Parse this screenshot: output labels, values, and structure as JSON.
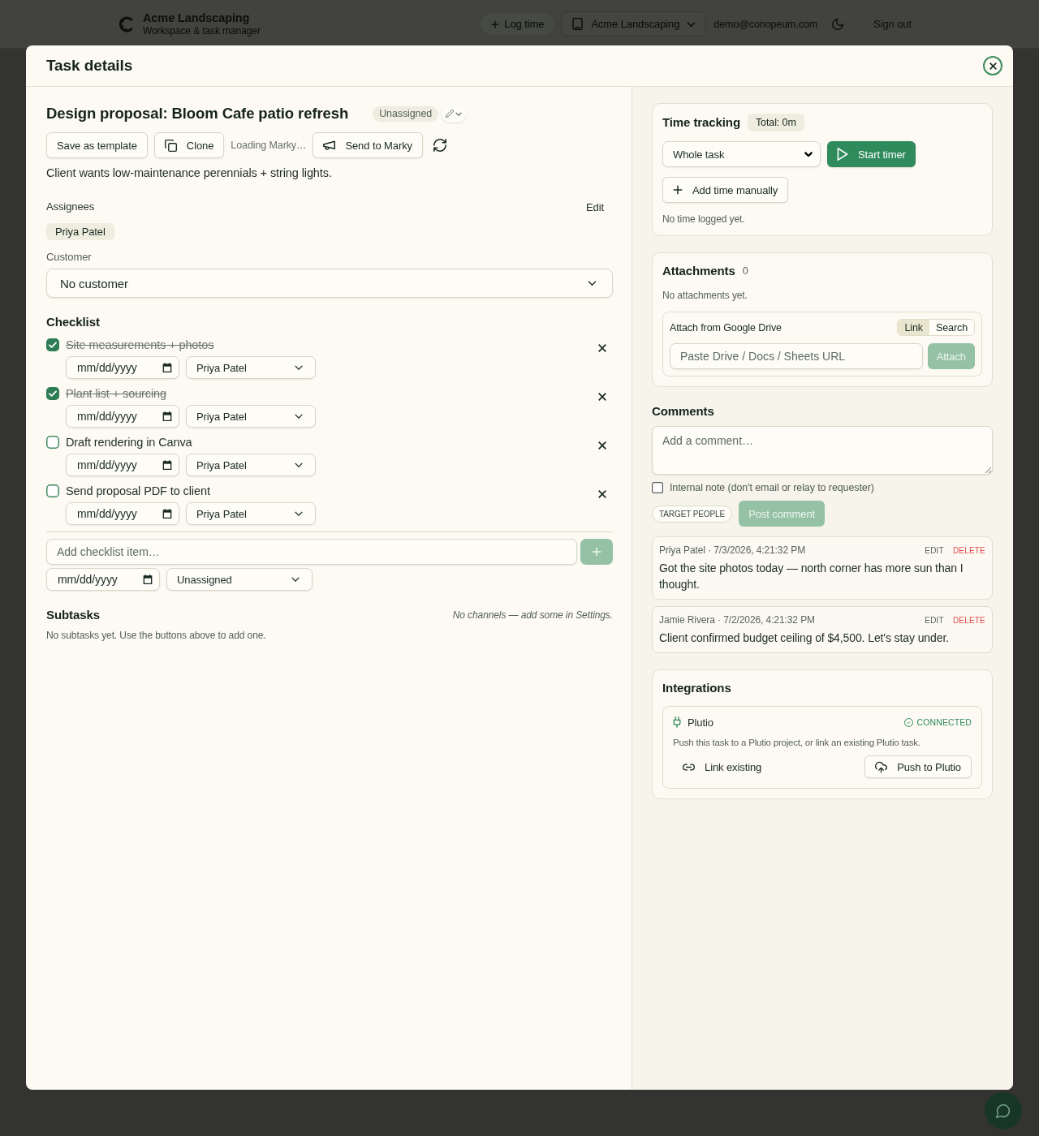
{
  "app_bar": {
    "brand_name": "Acme Landscaping",
    "brand_tagline": "Workspace & task manager",
    "log_time": "Log time",
    "workspace": "Acme Landscaping",
    "email": "demo@conopeum.com",
    "sign_out": "Sign out"
  },
  "dialog": {
    "title": "Task details"
  },
  "task": {
    "title": "Design proposal: Bloom Cafe patio refresh",
    "status_badge": "Unassigned",
    "actions": [
      {
        "kind": "template",
        "label": "Save as template"
      },
      {
        "kind": "clone",
        "label": "Clone"
      },
      {
        "kind": "status",
        "label": "Loading Marky…"
      },
      {
        "kind": "send",
        "label": "Send to Marky"
      },
      {
        "kind": "refresh"
      }
    ],
    "description": "Client wants low-maintenance perennials + string lights.",
    "assignees": {
      "label": "Assignees",
      "edit": "Edit",
      "people": [
        "Priya Patel"
      ]
    },
    "customer": {
      "label": "Customer",
      "value": "No customer"
    }
  },
  "checklist": {
    "title": "Checklist",
    "items": [
      {
        "text": "Site measurements + photos",
        "checked": true,
        "due_placeholder": "mm/dd/yyyy",
        "assignee": "Priya Patel"
      },
      {
        "text": "Plant list + sourcing",
        "checked": true,
        "due_placeholder": "mm/dd/yyyy",
        "assignee": "Priya Patel"
      },
      {
        "text": "Draft rendering in Canva",
        "checked": false,
        "due_placeholder": "mm/dd/yyyy",
        "assignee": "Priya Patel"
      },
      {
        "text": "Send proposal PDF to client",
        "checked": false,
        "due_placeholder": "mm/dd/yyyy",
        "assignee": "Priya Patel"
      }
    ],
    "new_item": {
      "placeholder": "Add checklist item…",
      "add_disabled": true,
      "due_placeholder": "mm/dd/yyyy",
      "assignee": "Unassigned"
    }
  },
  "subtasks": {
    "title": "Subtasks",
    "note": "No channels — add some in Settings.",
    "empty": "No subtasks yet. Use the buttons above to add one."
  },
  "time_tracking": {
    "title": "Time tracking",
    "total": "Total: 0m",
    "scope": "Whole task",
    "start_button": "Start timer",
    "add_button": "Add time manually",
    "empty": "No time logged yet."
  },
  "attachments": {
    "title": "Attachments",
    "count": "0",
    "empty": "No attachments yet.",
    "drive": {
      "label": "Attach from Google Drive",
      "modes": [
        {
          "label": "Link",
          "selected": true
        },
        {
          "label": "Search",
          "selected": false
        }
      ],
      "placeholder": "Paste Drive / Docs / Sheets URL",
      "attach_button": {
        "label": "Attach",
        "disabled": true
      }
    }
  },
  "comments": {
    "title": "Comments",
    "placeholder": "Add a comment…",
    "internal_note": {
      "label": "Internal note (don't email or relay to requester)",
      "checked": false
    },
    "target_button": "TARGET PEOPLE",
    "post_button": {
      "label": "Post comment",
      "disabled": true
    },
    "items": [
      {
        "meta": "Priya Patel · 7/3/2026, 4:21:32 PM",
        "edit": "EDIT",
        "delete": "DELETE",
        "body": "Got the site photos today — north corner has more sun than I thought."
      },
      {
        "meta": "Jamie Rivera · 7/2/2026, 4:21:32 PM",
        "edit": "EDIT",
        "delete": "DELETE",
        "body": "Client confirmed budget ceiling of $4,500. Let's stay under."
      }
    ]
  },
  "integrations": {
    "title": "Integrations",
    "items": [
      {
        "name": "Plutio",
        "status": "CONNECTED",
        "connected": true,
        "description": "Push this task to a Plutio project, or link an existing Plutio task.",
        "link_button": "Link existing",
        "push_button": "Push to Plutio"
      }
    ]
  }
}
